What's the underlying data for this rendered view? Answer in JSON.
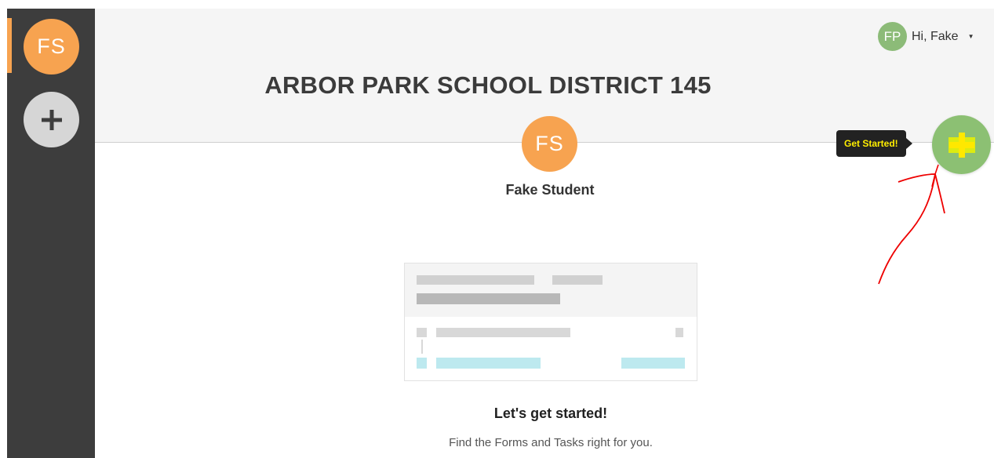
{
  "sidebar": {
    "active_avatar_initials": "FS",
    "add_icon": "plus-icon"
  },
  "header": {
    "user": {
      "initials": "FP",
      "greeting": "Hi, Fake",
      "caret_icon": "caret-down-icon"
    },
    "title": "ARBOR PARK SCHOOL DISTRICT 145"
  },
  "student": {
    "initials": "FS",
    "name": "Fake Student"
  },
  "get_started": {
    "tooltip": "Get Started!",
    "icon": "plus-icon"
  },
  "empty_state": {
    "headline": "Let's get started!",
    "subline": "Find the Forms and Tasks right for you."
  },
  "colors": {
    "accent_orange": "#f7a350",
    "accent_green": "#8cc073",
    "sidebar_bg": "#3d3d3d",
    "tooltip_text": "#ffee00",
    "annotation_red": "#ee0000"
  }
}
